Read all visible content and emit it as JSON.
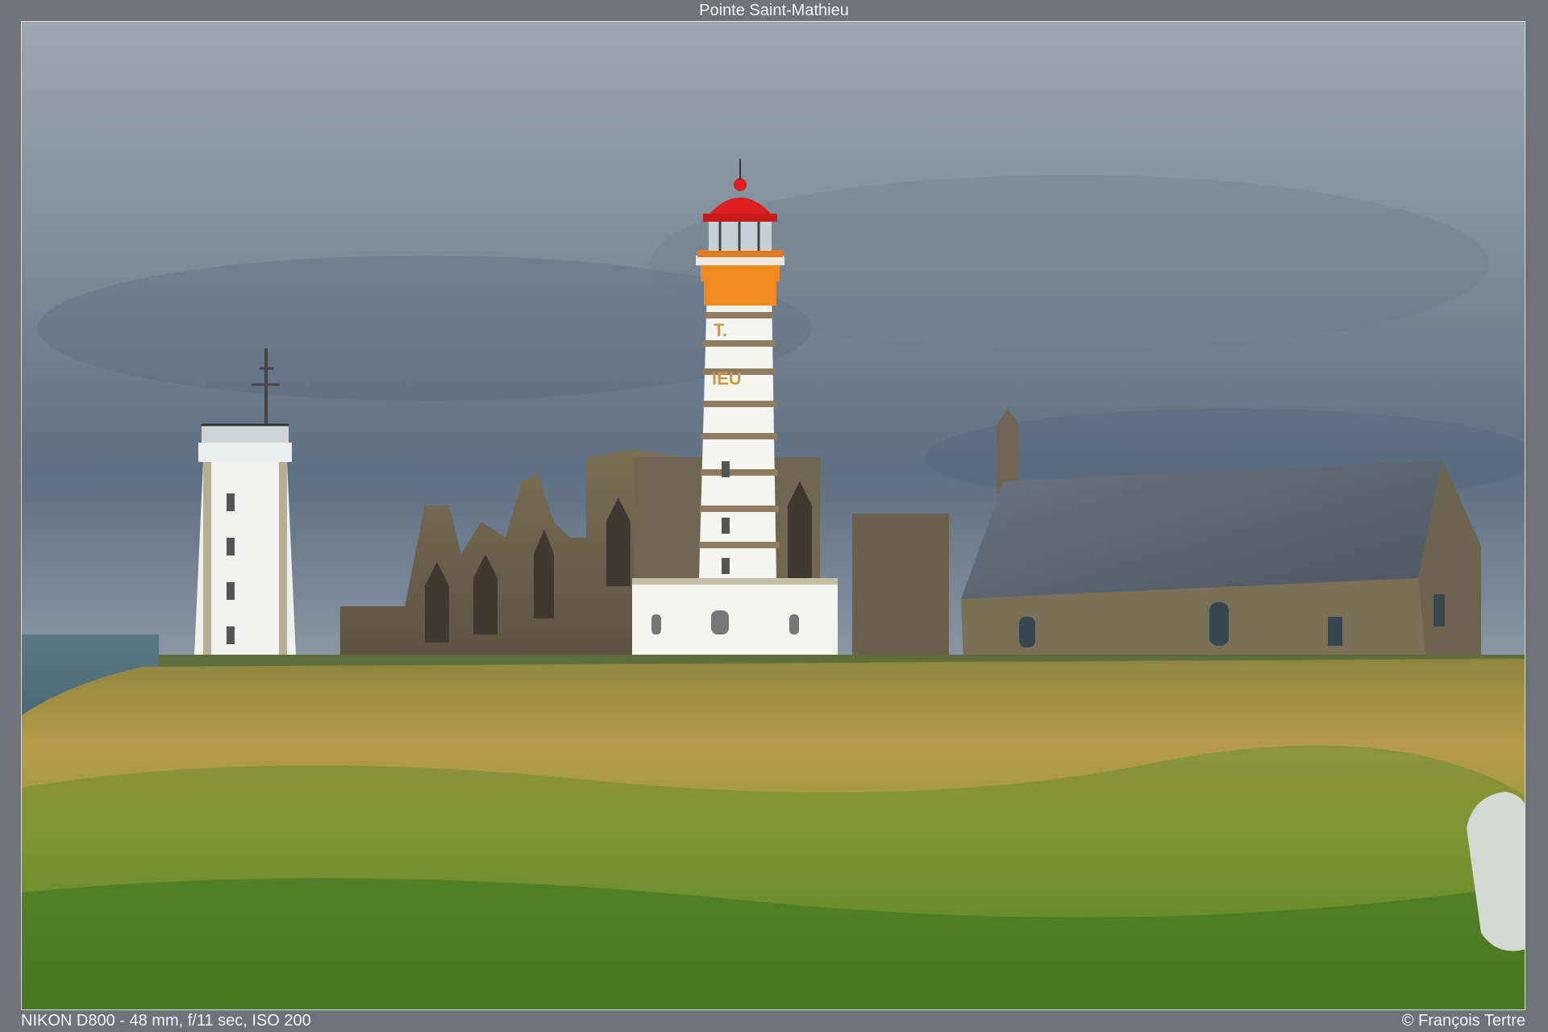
{
  "title": "Pointe Saint-Mathieu",
  "exif": "NIKON D800 - 48 mm, f/11 sec, ISO 200",
  "copyright": "© François Tertre",
  "lighthouse_text": [
    "T.",
    "IEU"
  ]
}
